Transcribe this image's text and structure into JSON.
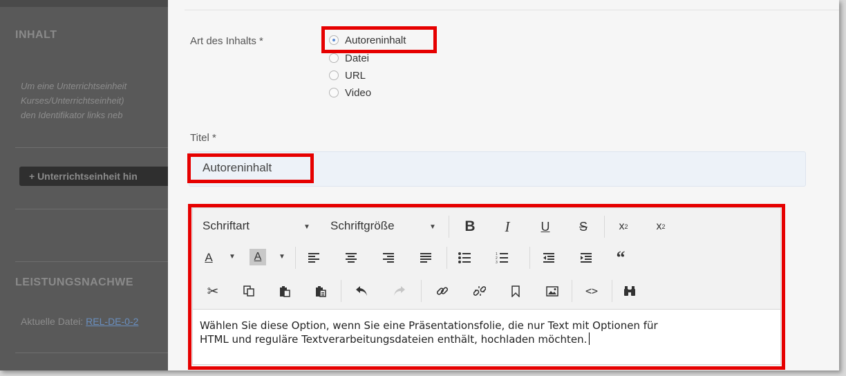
{
  "background": {
    "inhalt_heading": "INHALT",
    "italic_lines": [
      "Um eine Unterrichtseinheit",
      "Kurses/Unterrichtseinheit)",
      "den Identifikator links neb"
    ],
    "add_unit_button": "+ Unterrichtseinheit hin",
    "leistung_heading": "LEISTUNGSNACHWE",
    "current_file_label": "Aktuelle Datei:",
    "current_file_link": "REL-DE-0-2"
  },
  "form": {
    "content_type_label": "Art des Inhalts *",
    "content_type_options": [
      {
        "label": "Autoreninhalt",
        "checked": true
      },
      {
        "label": "Datei",
        "checked": false
      },
      {
        "label": "URL",
        "checked": false
      },
      {
        "label": "Video",
        "checked": false
      }
    ],
    "title_label": "Titel *",
    "title_value": "Autoreninhalt",
    "editor": {
      "font_dropdown": "Schriftart",
      "size_dropdown": "Schriftgröße",
      "content_line1": "Wählen Sie diese Option, wenn Sie eine Präsentationsfolie, die nur Text mit Optionen für",
      "content_line2": "HTML und reguläre Textverarbeitungsdateien enthält, hochladen möchten."
    }
  },
  "highlight_color": "#e60000",
  "toolbar_icons": [
    "bold-icon",
    "italic-icon",
    "underline-icon",
    "strikethrough-icon",
    "subscript-icon",
    "superscript-icon",
    "text-color-icon",
    "background-color-icon",
    "align-left-icon",
    "align-center-icon",
    "align-right-icon",
    "justify-icon",
    "bullet-list-icon",
    "numbered-list-icon",
    "outdent-icon",
    "indent-icon",
    "blockquote-icon",
    "cut-icon",
    "copy-icon",
    "paste-icon",
    "paste-text-icon",
    "undo-icon",
    "redo-icon",
    "link-icon",
    "unlink-icon",
    "anchor-icon",
    "image-icon",
    "source-code-icon",
    "find-icon"
  ]
}
